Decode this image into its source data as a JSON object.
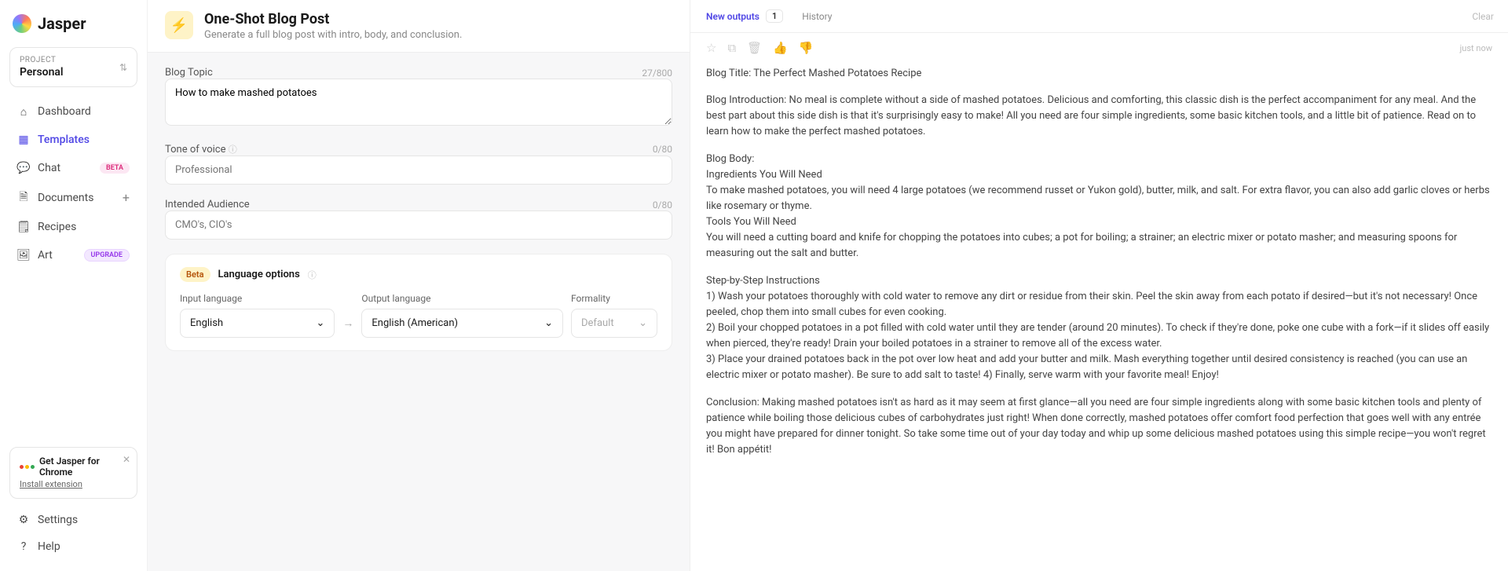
{
  "brand": {
    "name": "Jasper"
  },
  "project": {
    "label": "PROJECT",
    "name": "Personal"
  },
  "nav": {
    "dashboard": "Dashboard",
    "templates": "Templates",
    "chat": "Chat",
    "chat_badge": "BETA",
    "documents": "Documents",
    "recipes": "Recipes",
    "art": "Art",
    "art_badge": "UPGRADE",
    "settings": "Settings",
    "help": "Help"
  },
  "chrome": {
    "title": "Get Jasper for Chrome",
    "link": "Install extension"
  },
  "page": {
    "title": "One-Shot Blog Post",
    "subtitle": "Generate a full blog post with intro, body, and conclusion."
  },
  "fields": {
    "topic_label": "Blog Topic",
    "topic_counter": "27/800",
    "topic_value": "How to make mashed potatoes",
    "tone_label": "Tone of voice",
    "tone_counter": "0/80",
    "tone_placeholder": "Professional",
    "audience_label": "Intended Audience",
    "audience_counter": "0/80",
    "audience_placeholder": "CMO's, CIO's"
  },
  "lang": {
    "badge": "Beta",
    "title": "Language options",
    "input_label": "Input language",
    "input_value": "English",
    "output_label": "Output language",
    "output_value": "English (American)",
    "formality_label": "Formality",
    "formality_value": "Default"
  },
  "output": {
    "tab_new": "New outputs",
    "tab_count": "1",
    "tab_history": "History",
    "clear": "Clear",
    "time": "just now",
    "title": "Blog Title: The Perfect Mashed Potatoes Recipe",
    "intro": "Blog Introduction: No meal is complete without a side of mashed potatoes. Delicious and comforting, this classic dish is the perfect accompaniment for any meal. And the best part about this side dish is that it's surprisingly easy to make! All you need are four simple ingredients, some basic kitchen tools, and a little bit of patience. Read on to learn how to make the perfect mashed potatoes.",
    "body_label": "Blog Body:",
    "ing_head": "Ingredients You Will Need",
    "ing_body": "To make mashed potatoes, you will need 4 large potatoes (we recommend russet or Yukon gold), butter, milk, and salt. For extra flavor, you can also add garlic cloves or herbs like rosemary or thyme.",
    "tools_head": "Tools You Will Need",
    "tools_body": "You will need a cutting board and knife for chopping the potatoes into cubes; a pot for boiling; a strainer; an electric mixer or potato masher; and measuring spoons for measuring out the salt and butter.",
    "steps_head": "Step-by-Step Instructions",
    "step1": "1) Wash your potatoes thoroughly with cold water to remove any dirt or residue from their skin. Peel the skin away from each potato if desired—but it's not necessary! Once peeled, chop them into small cubes for even cooking.",
    "step2": "2) Boil your chopped potatoes in a pot filled with cold water until they are tender (around 20 minutes). To check if they're done, poke one cube with a fork—if it slides off easily when pierced, they're ready! Drain your boiled potatoes in a strainer to remove all of the excess water.",
    "step3": "3) Place your drained potatoes back in the pot over low heat and add your butter and milk. Mash everything together until desired consistency is reached (you can use an electric mixer or potato masher). Be sure to add salt to taste!                                      4) Finally, serve warm with your favorite meal! Enjoy!",
    "conclusion": "Conclusion: Making mashed potatoes isn't as hard as it may seem at first glance—all you need are four simple ingredients along with some basic kitchen tools and plenty of patience while boiling those delicious cubes of carbohydrates just right! When done correctly, mashed potatoes offer comfort food perfection that goes well with any entrée you might have prepared for dinner tonight. So take some time out of your day today and whip up some delicious mashed potatoes using this simple recipe—you won't regret it! Bon appétit!"
  }
}
